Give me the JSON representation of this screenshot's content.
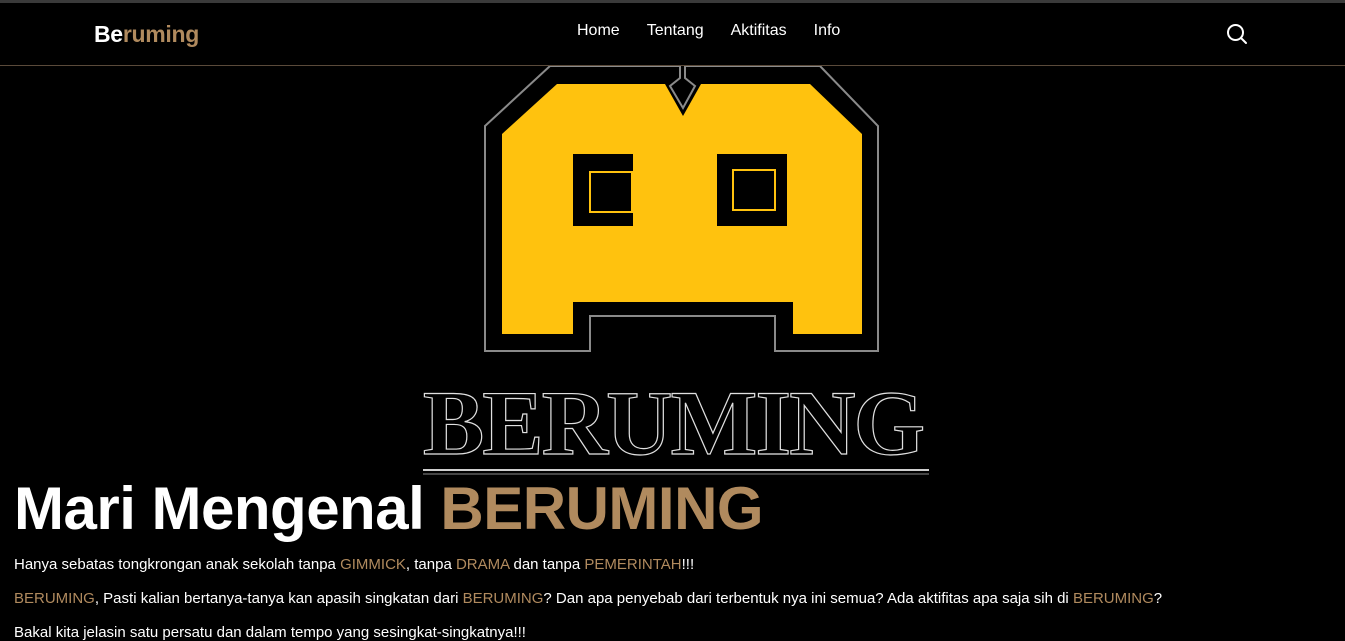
{
  "header": {
    "brand_part1": "Be",
    "brand_part2": "ruming",
    "nav": [
      "Home",
      "Tentang",
      "Aktifitas",
      "Info"
    ],
    "search_icon": "search-icon"
  },
  "hero": {
    "logo_text": "BERUMING",
    "title_part1": "Mari Mengenal ",
    "title_part2": "BERUMING"
  },
  "paragraphs": {
    "p1": [
      "Hanya sebatas tongkrongan anak sekolah tanpa ",
      "GIMMICK",
      ", tanpa ",
      "DRAMA",
      " dan tanpa ",
      "PEMERINTAH",
      "!!!"
    ],
    "p2": [
      "BERUMING",
      ", Pasti kalian bertanya-tanya kan apasih singkatan dari ",
      "BERUMING",
      "? Dan apa penyebab dari terbentuk nya ini semua? Ada aktifitas apa saja sih di ",
      "BERUMING",
      "?"
    ],
    "p3": "Bakal kita jelasin satu persatu dan dalam tempo yang sesingkat-singkatnya!!!"
  },
  "colors": {
    "accent": "#b08a5e",
    "logo_yellow": "#ffc20e",
    "background": "#000000",
    "text": "#ffffff"
  }
}
